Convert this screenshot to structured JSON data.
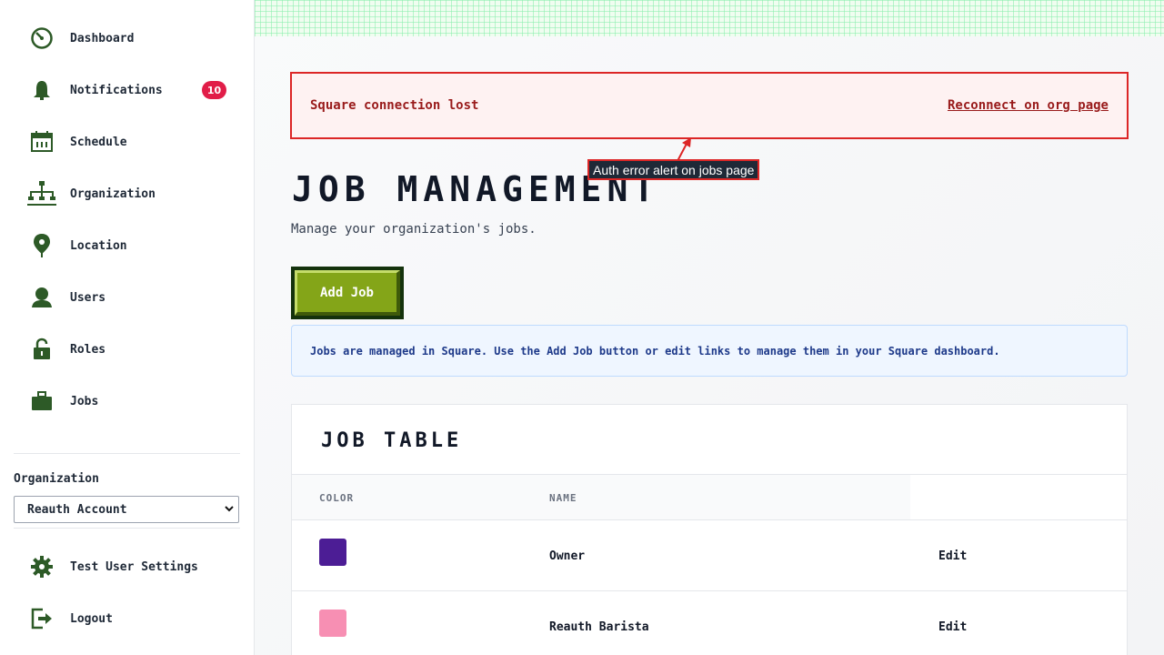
{
  "sidebar": {
    "items": [
      {
        "label": "Dashboard",
        "icon": "dashboard-gauge-icon"
      },
      {
        "label": "Notifications",
        "icon": "bell-icon",
        "badge": "10"
      },
      {
        "label": "Schedule",
        "icon": "calendar-icon"
      },
      {
        "label": "Organization",
        "icon": "org-chart-icon"
      },
      {
        "label": "Location",
        "icon": "map-pin-icon"
      },
      {
        "label": "Users",
        "icon": "user-icon"
      },
      {
        "label": "Roles",
        "icon": "unlock-icon"
      },
      {
        "label": "Jobs",
        "icon": "briefcase-icon"
      }
    ],
    "org_label": "Organization",
    "org_selected": "Reauth Account",
    "footer": [
      {
        "label": "Test User Settings",
        "icon": "gear-icon"
      },
      {
        "label": "Logout",
        "icon": "logout-icon"
      }
    ]
  },
  "alert": {
    "message": "Square connection lost",
    "link": "Reconnect on org page"
  },
  "annotation": {
    "label": "Auth error alert on jobs page"
  },
  "page": {
    "title": "JOB MANAGEMENT",
    "subtitle": "Manage your organization's jobs.",
    "add_button": "Add Job",
    "info": "Jobs are managed in Square. Use the Add Job button or edit links to manage them in your Square dashboard."
  },
  "table": {
    "title": "JOB TABLE",
    "headers": [
      "COLOR",
      "NAME"
    ],
    "rows": [
      {
        "color": "#4c1d95",
        "name": "Owner",
        "action": "Edit"
      },
      {
        "color": "#f78fb3",
        "name": "Reauth Barista",
        "action": "Edit"
      }
    ]
  },
  "colors": {
    "accent_green": "#84a518",
    "icon_green": "#2d5a27",
    "alert_red": "#dc2626",
    "badge_red": "#e11d48"
  }
}
